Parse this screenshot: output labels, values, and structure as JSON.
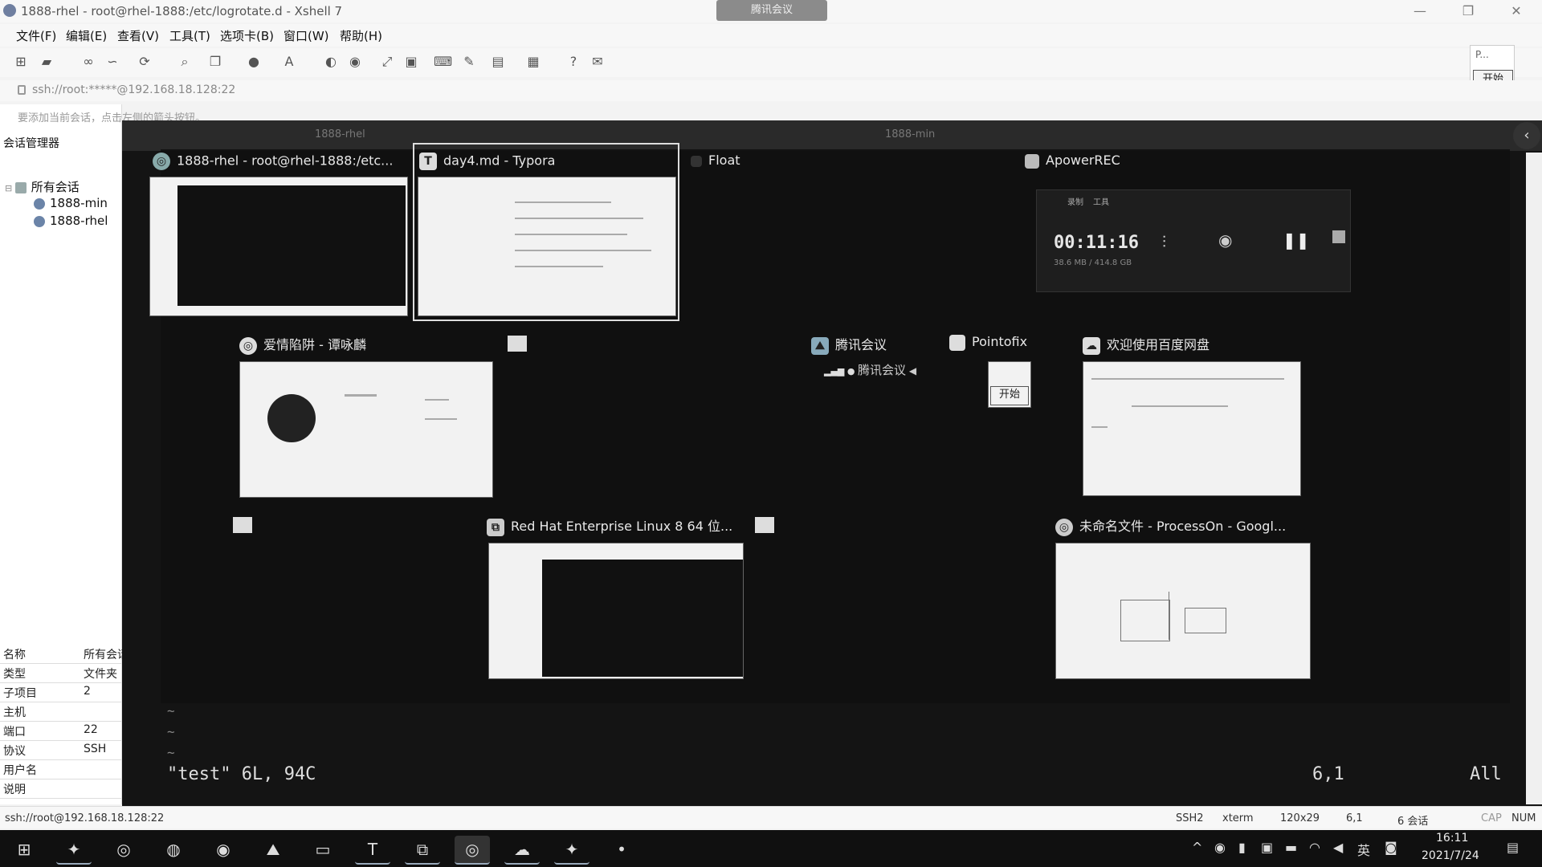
{
  "window": {
    "title": "1888-rhel - root@rhel-1888:/etc/logrotate.d - Xshell 7",
    "meeting_pill": "腾讯会议",
    "controls": [
      "—",
      "❐",
      "✕"
    ]
  },
  "menu": [
    "文件(F)",
    "编辑(E)",
    "查看(V)",
    "工具(T)",
    "选项卡(B)",
    "窗口(W)",
    "帮助(H)"
  ],
  "toolbar_icons": [
    "new-session-icon",
    "open-folder-icon",
    "link-icon",
    "disconnect-icon",
    "reconnect-icon",
    "find-icon",
    "copy-icon",
    "globe-icon",
    "font-icon",
    "xftp-icon",
    "xagent-icon",
    "fullscreen-icon",
    "lock-icon",
    "keyboard-icon",
    "script-icon",
    "compose-icon",
    "layout-icon",
    "help-icon",
    "chat-icon"
  ],
  "address": "ssh://root:*****@192.168.18.128:22",
  "mini_widget": {
    "label": "P...",
    "button": "开始"
  },
  "session_panel": {
    "hint": "要添加当前会话，点击左侧的箭头按钮。",
    "title": "会话管理器",
    "root": "所有会话",
    "items": [
      "1888-min",
      "1888-rhel"
    ],
    "props": [
      {
        "k": "名称",
        "v": "所有会话"
      },
      {
        "k": "类型",
        "v": "文件夹"
      },
      {
        "k": "子项目",
        "v": "2"
      },
      {
        "k": "主机",
        "v": ""
      },
      {
        "k": "端口",
        "v": "22"
      },
      {
        "k": "协议",
        "v": "SSH"
      },
      {
        "k": "用户名",
        "v": ""
      },
      {
        "k": "说明",
        "v": ""
      }
    ]
  },
  "terminal": {
    "tabs": [
      "1888-rhel",
      "1888-min"
    ],
    "status_line": "\"test\" 6L, 94C",
    "cursor_pos": "6,1",
    "scroll_pos": "All",
    "tilde": "~"
  },
  "switcher": {
    "windows": [
      {
        "title": "1888-rhel - root@rhel-1888:/etc..."
      },
      {
        "title": "day4.md - Typora"
      },
      {
        "title": "Float"
      },
      {
        "title": "ApowerREC"
      },
      {
        "title": "爱情陷阱 - 谭咏麟"
      },
      {
        "title": "腾讯会议",
        "sub": "腾讯会议"
      },
      {
        "title": "Pointofix",
        "button": "开始"
      },
      {
        "title": "欢迎使用百度网盘"
      },
      {
        "title": "Red Hat Enterprise Linux 8 64 位..."
      },
      {
        "title": "未命名文件 - ProcessOn - Googl..."
      }
    ],
    "apowerrec": {
      "tabs": [
        "录制",
        "工具"
      ],
      "time": "00:11:16",
      "size": "38.6 MB / 414.8 GB"
    }
  },
  "statusbar": {
    "address": "ssh://root@192.168.18.128:22",
    "protocol": "SSH2",
    "term": "xterm",
    "size": "120x29",
    "pos": "6,1",
    "sessions": "6 会话",
    "cap": "CAP",
    "num": "NUM"
  },
  "taskbar": {
    "icons": [
      "windows-start-icon",
      "xshell-icon",
      "chrome-icon",
      "wechat-icon",
      "netease-music-icon",
      "tencent-meeting-icon",
      "file-explorer-icon",
      "typora-icon",
      "vmware-icon",
      "xshell-active-icon",
      "baidu-netdisk-icon",
      "apowerrec-icon",
      "recorder-icon"
    ],
    "tray_lang": "英",
    "time": "16:11",
    "date": "2021/7/24"
  }
}
